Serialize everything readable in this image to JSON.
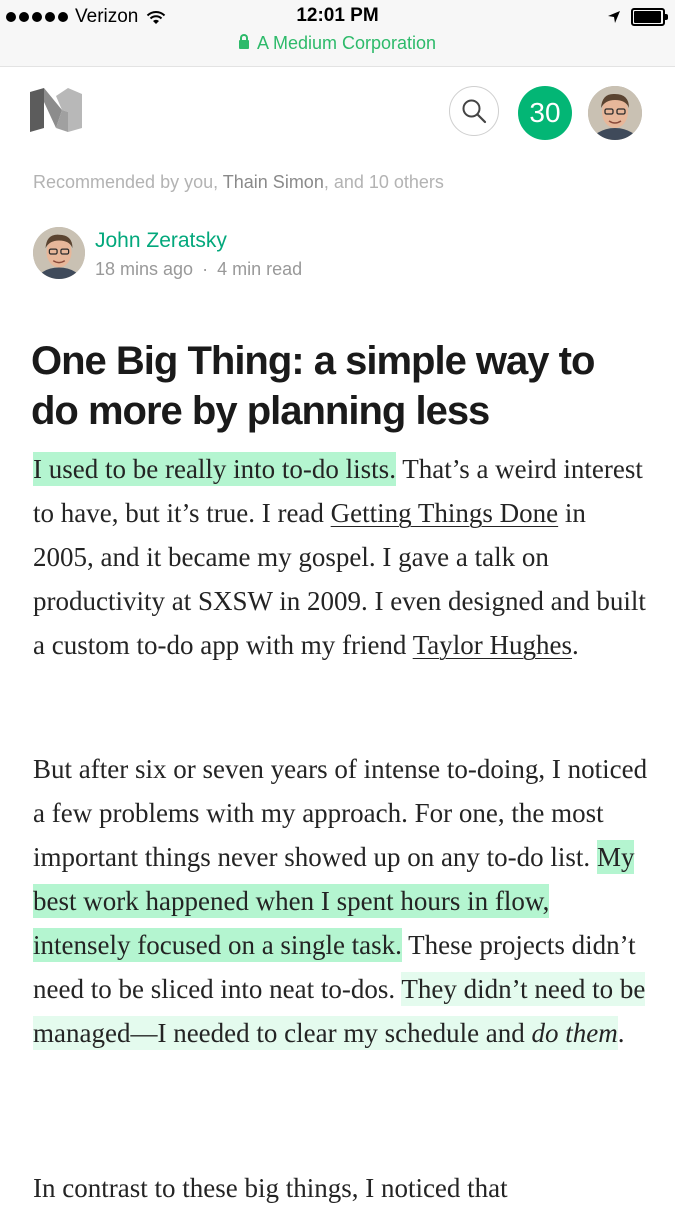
{
  "status_bar": {
    "carrier": "Verizon",
    "time": "12:01 PM",
    "domain": "A Medium Corporation"
  },
  "header": {
    "notification_count": "30"
  },
  "recommended": {
    "prefix": "Recommended by you, ",
    "name": "Thain Simon",
    "suffix": ", and 10 others"
  },
  "author": {
    "name": "John Zeratsky",
    "time_ago": "18 mins ago",
    "separator": "·",
    "read_time": "4 min read"
  },
  "article": {
    "title": "One Big Thing: a simple way to do more by planning less",
    "p1": {
      "highlight": "I used to be really into to-do lists.",
      "t1": " That’s a weird interest to have, but it’s true. I read ",
      "link1": "Getting Things Done",
      "t2": " in 2005, and it became my gospel. I gave a talk on productivity at SXSW in 2009. I even designed and built a custom to-do app with my friend ",
      "link2": "Taylor Hughes",
      "t3": "."
    },
    "p2": {
      "t1": "But after six or seven years of intense to-doing, I noticed a few problems with my approach. For one, the most important things never showed up on any to-do list. ",
      "highlight1": "My best work happened when I spent hours in flow, intensely focused on a single task.",
      "t2": " These projects didn’t need to be sliced into neat to-dos. ",
      "highlight2": "They didn’t need to be managed—I needed to clear my schedule and ",
      "highlight2_em": "do them",
      "highlight2_end": "."
    },
    "p3": {
      "t1": "In contrast to these big things, I noticed that"
    }
  },
  "colors": {
    "brand_green": "#03b675",
    "highlight": "#b4f5d0",
    "highlight_light": "#e4fbee"
  }
}
